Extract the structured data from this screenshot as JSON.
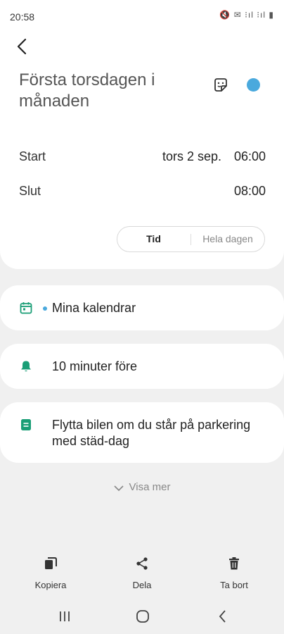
{
  "status_bar": {
    "time": "20:58",
    "icons_text": "🔇 ✉ ⁝ıl ⁝ıl ▮"
  },
  "event": {
    "title": "Första torsdagen i månaden",
    "color": "#4aa9dd"
  },
  "schedule": {
    "start_label": "Start",
    "start_date": "tors 2 sep.",
    "start_time": "06:00",
    "end_label": "Slut",
    "end_time": "08:00",
    "toggle": {
      "option_time": "Tid",
      "option_all_day": "Hela dagen",
      "selected": "Tid"
    }
  },
  "calendar": {
    "name": "Mina kalendrar",
    "color": "#4aa9dd",
    "icon": "calendar-icon"
  },
  "reminder": {
    "text": "10 minuter före",
    "icon": "bell-icon"
  },
  "note": {
    "text": "Flytta bilen om du står på parkering med städ-dag",
    "icon": "note-icon"
  },
  "show_more": "Visa mer",
  "actions": {
    "copy": "Kopiera",
    "share": "Dela",
    "delete": "Ta bort"
  },
  "colors": {
    "accent_green": "#1a9e76",
    "accent_blue": "#4aa9dd"
  }
}
